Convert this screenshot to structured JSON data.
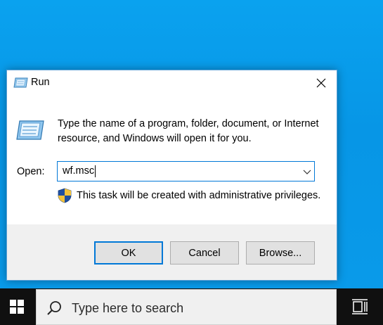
{
  "dialog": {
    "title": "Run",
    "description": "Type the name of a program, folder, document, or Internet resource, and Windows will open it for you.",
    "open_label": "Open:",
    "open_value": "wf.msc",
    "admin_note": "This task will be created with administrative privileges.",
    "buttons": {
      "ok": "OK",
      "cancel": "Cancel",
      "browse": "Browse..."
    }
  },
  "taskbar": {
    "search_placeholder": "Type here to search"
  },
  "icons": {
    "title": "run-icon",
    "close": "close-icon",
    "dialog": "run-program-icon",
    "combo": "chevron-down-icon",
    "shield": "uac-shield-icon",
    "start": "windows-logo-icon",
    "search": "search-icon",
    "taskview": "task-view-icon"
  },
  "colors": {
    "desktop": "#0aa2ef",
    "accent": "#0078d7",
    "taskbar": "#101010"
  }
}
